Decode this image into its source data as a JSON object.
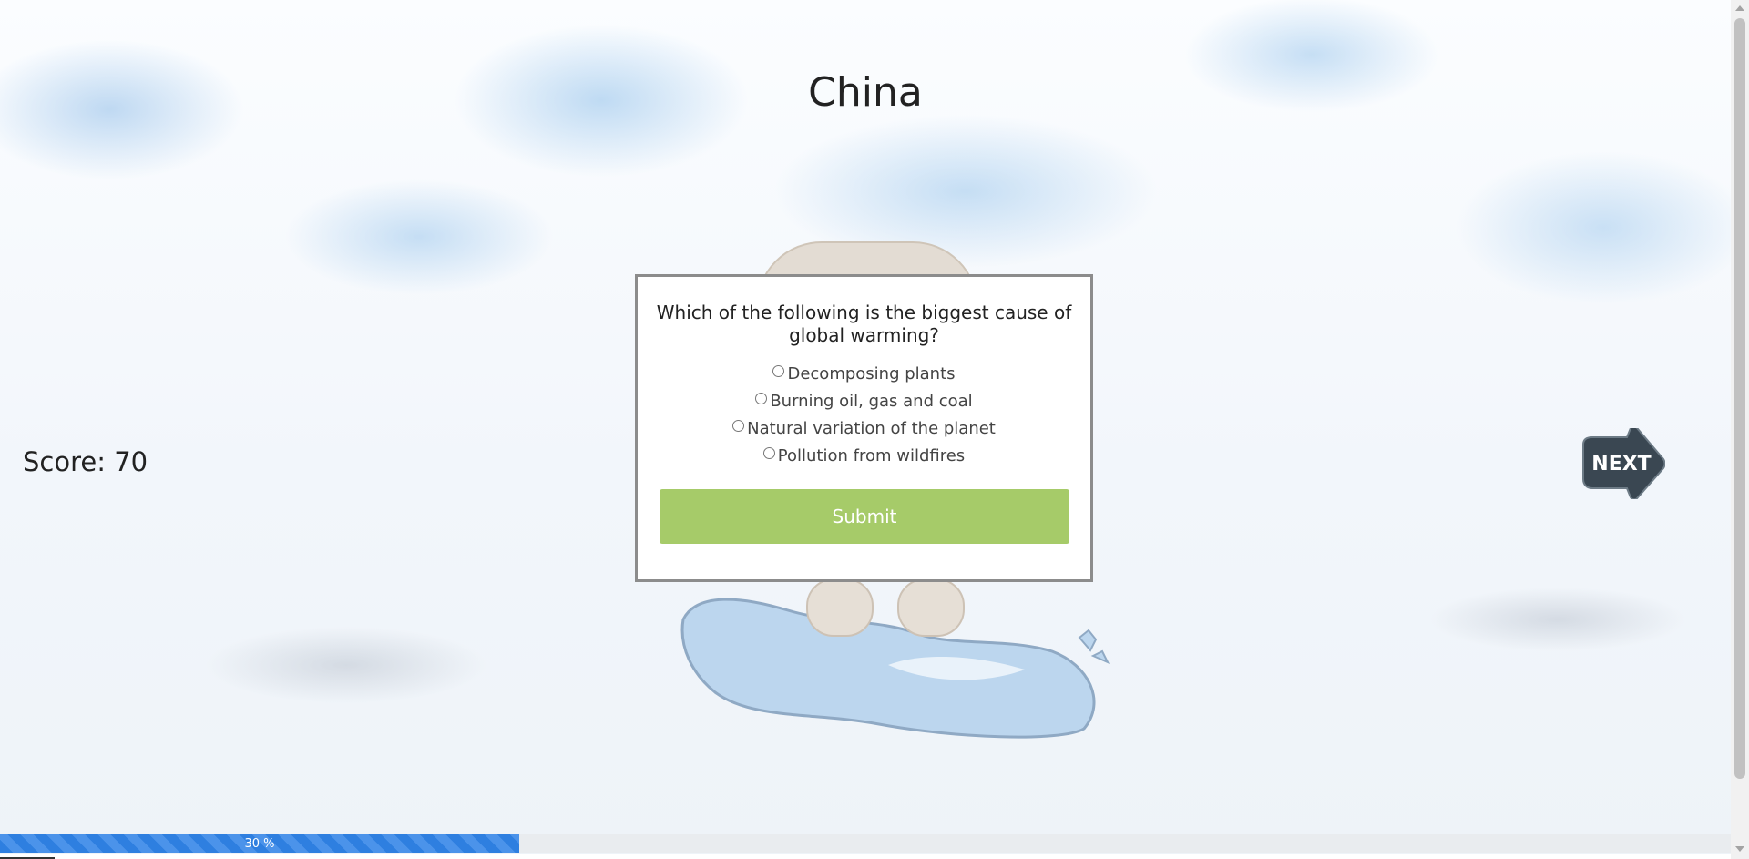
{
  "page": {
    "title": "China"
  },
  "score": {
    "label": "Score: 70"
  },
  "quiz": {
    "question": "Which of the following is the biggest cause of global warming?",
    "options": [
      "Decomposing plants",
      "Burning oil, gas and coal",
      "Natural variation of the planet",
      "Pollution from wildfires"
    ],
    "submit_label": "Submit"
  },
  "next_button": {
    "label": "NEXT",
    "icon": "next-arrow-icon"
  },
  "progress": {
    "value": 30,
    "label": "30 %"
  },
  "colors": {
    "submit": "#a6cb69",
    "progress": "#2e7fe0",
    "next_button": "#3a4752"
  }
}
